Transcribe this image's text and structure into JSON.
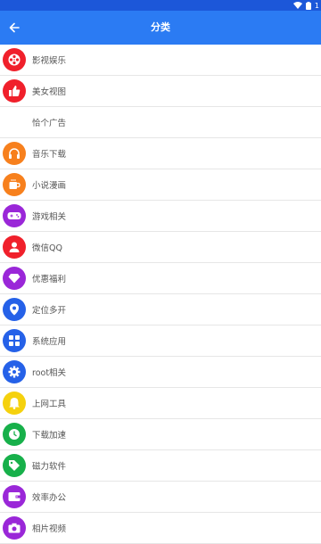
{
  "app": {
    "title": "分类"
  },
  "status_bar": {
    "battery_text": "1"
  },
  "categories": [
    {
      "label": "影视娱乐",
      "icon": "film-reel-icon",
      "color": "#f0202b"
    },
    {
      "label": "美女视图",
      "icon": "thumbs-up-icon",
      "color": "#f0202b"
    },
    {
      "label": "恰个广告",
      "icon": "",
      "color": ""
    },
    {
      "label": "音乐下载",
      "icon": "headphones-icon",
      "color": "#f7801d"
    },
    {
      "label": "小说漫画",
      "icon": "coffee-cup-icon",
      "color": "#f7801d"
    },
    {
      "label": "游戏相关",
      "icon": "gamepad-icon",
      "color": "#9a27d8"
    },
    {
      "label": "微信QQ",
      "icon": "user-icon",
      "color": "#f0202b"
    },
    {
      "label": "优惠福利",
      "icon": "diamond-icon",
      "color": "#9a27d8"
    },
    {
      "label": "定位多开",
      "icon": "location-pin-icon",
      "color": "#2561e8"
    },
    {
      "label": "系统应用",
      "icon": "apps-grid-icon",
      "color": "#2561e8"
    },
    {
      "label": "root相关",
      "icon": "gear-icon",
      "color": "#2561e8"
    },
    {
      "label": "上网工具",
      "icon": "bell-icon",
      "color": "#f5d10d"
    },
    {
      "label": "下载加速",
      "icon": "clock-icon",
      "color": "#17b04a"
    },
    {
      "label": "磁力软件",
      "icon": "tag-icon",
      "color": "#17b04a"
    },
    {
      "label": "效率办公",
      "icon": "wallet-icon",
      "color": "#9a27d8"
    },
    {
      "label": "相片视频",
      "icon": "camera-icon",
      "color": "#9a27d8"
    }
  ]
}
